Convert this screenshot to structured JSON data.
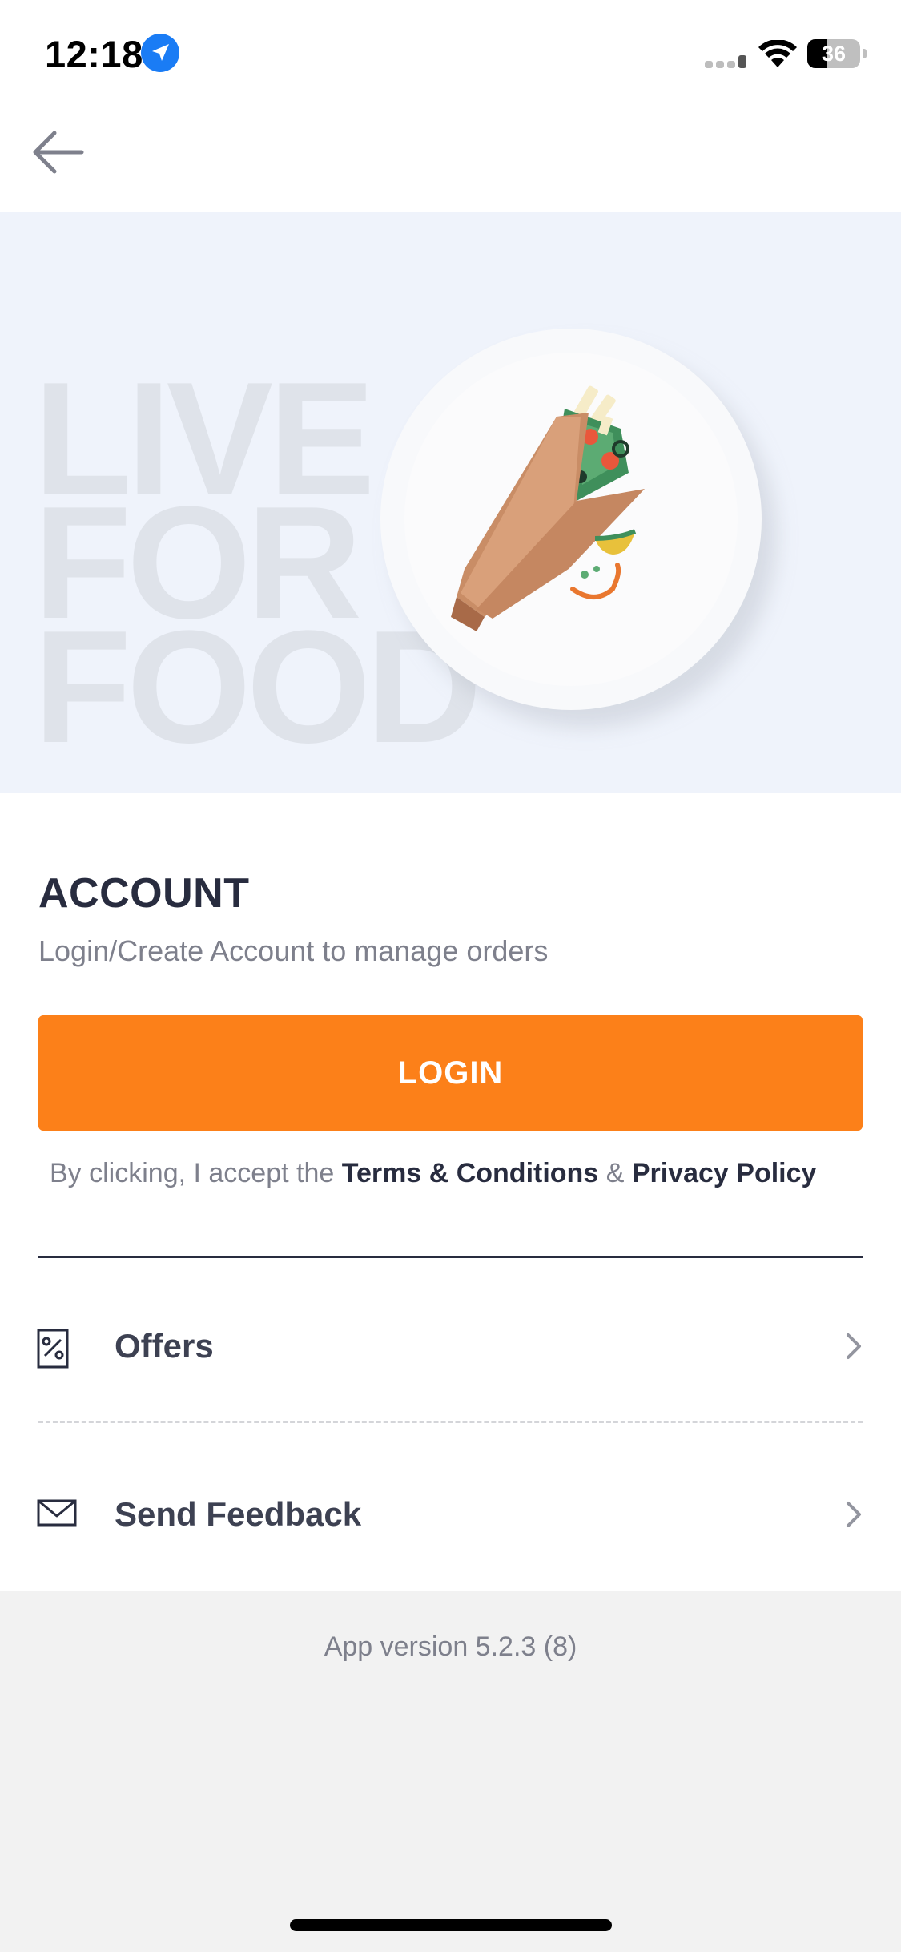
{
  "status_bar": {
    "time": "12:18",
    "battery": "36",
    "battery_level": 0.36,
    "icons": [
      "location-arrow-icon",
      "cellular-signal-icon",
      "wifi-icon",
      "battery-icon"
    ]
  },
  "nav": {
    "back_icon": "arrow-left-icon"
  },
  "hero": {
    "words": [
      "LIVE",
      "FOR",
      "FOOD"
    ],
    "illustration": "wrap-on-plate-illustration"
  },
  "account": {
    "title": "ACCOUNT",
    "subtitle": "Login/Create Account to manage orders",
    "login_label": "LOGIN",
    "terms_prefix": "By clicking, I accept the",
    "terms_link": "Terms & Conditions",
    "terms_joiner": "&",
    "privacy_link": "Privacy Policy"
  },
  "menu": [
    {
      "label": "Offers",
      "icon": "offer-percent-icon"
    },
    {
      "label": "Send Feedback",
      "icon": "envelope-icon"
    }
  ],
  "footer": {
    "app_version": "App version 5.2.3 (8)"
  },
  "colors": {
    "accent": "#fc8019",
    "hero_bg": "#eff3fb",
    "text_dark": "#282c3f",
    "text_muted": "#7e808c",
    "footer_bg": "#f2f2f2"
  }
}
